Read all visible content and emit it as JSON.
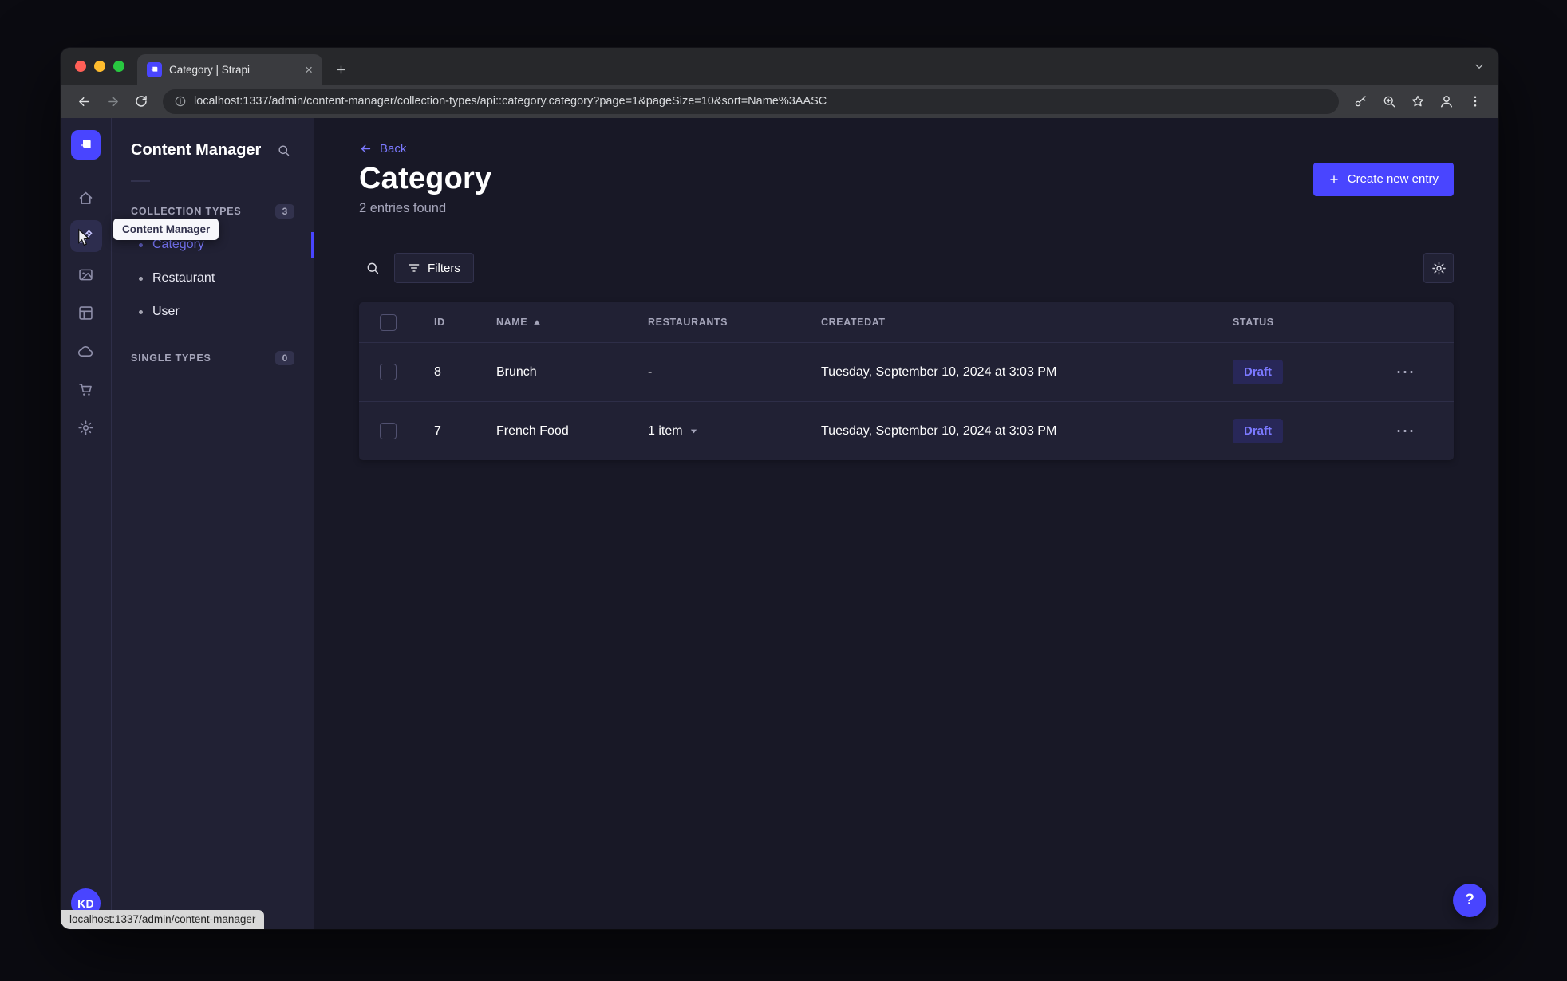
{
  "window": {
    "tab_title": "Category | Strapi",
    "url": "localhost:1337/admin/content-manager/collection-types/api::category.category?page=1&pageSize=10&sort=Name%3AASC",
    "status_bubble": "localhost:1337/admin/content-manager"
  },
  "navbar": {
    "tooltip": "Content Manager",
    "avatar_initials": "KD",
    "items": [
      {
        "icon": "home-icon",
        "active": false
      },
      {
        "icon": "content-manager-icon",
        "active": true
      },
      {
        "icon": "media-library-icon",
        "active": false
      },
      {
        "icon": "content-type-builder-icon",
        "active": false
      },
      {
        "icon": "cloud-icon",
        "active": false
      },
      {
        "icon": "marketplace-cart-icon",
        "active": false
      },
      {
        "icon": "settings-gear-icon",
        "active": false
      }
    ]
  },
  "sidebar": {
    "title": "Content Manager",
    "collection_types": {
      "label": "COLLECTION TYPES",
      "count": "3",
      "items": [
        {
          "label": "Category",
          "active": true
        },
        {
          "label": "Restaurant",
          "active": false
        },
        {
          "label": "User",
          "active": false
        }
      ]
    },
    "single_types": {
      "label": "SINGLE TYPES",
      "count": "0"
    }
  },
  "main": {
    "back": "Back",
    "title": "Category",
    "subtitle": "2 entries found",
    "create_button": "Create new entry",
    "filters_button": "Filters",
    "help_label": "?",
    "table": {
      "headers": {
        "id": "ID",
        "name": "NAME",
        "restaurants": "RESTAURANTS",
        "created_at": "CREATEDAT",
        "status": "STATUS"
      },
      "rows": [
        {
          "id": "8",
          "name": "Brunch",
          "restaurants": "-",
          "created_at": "Tuesday, September 10, 2024 at 3:03 PM",
          "status": "Draft"
        },
        {
          "id": "7",
          "name": "French Food",
          "restaurants": "1 item",
          "created_at": "Tuesday, September 10, 2024 at 3:03 PM",
          "status": "Draft"
        }
      ]
    }
  },
  "colors": {
    "accent": "#4945ff",
    "accent_light": "#7b79ff",
    "app_background": "#181826",
    "surface": "#212134",
    "border": "#32324d",
    "text_secondary": "#a5a5ba"
  }
}
